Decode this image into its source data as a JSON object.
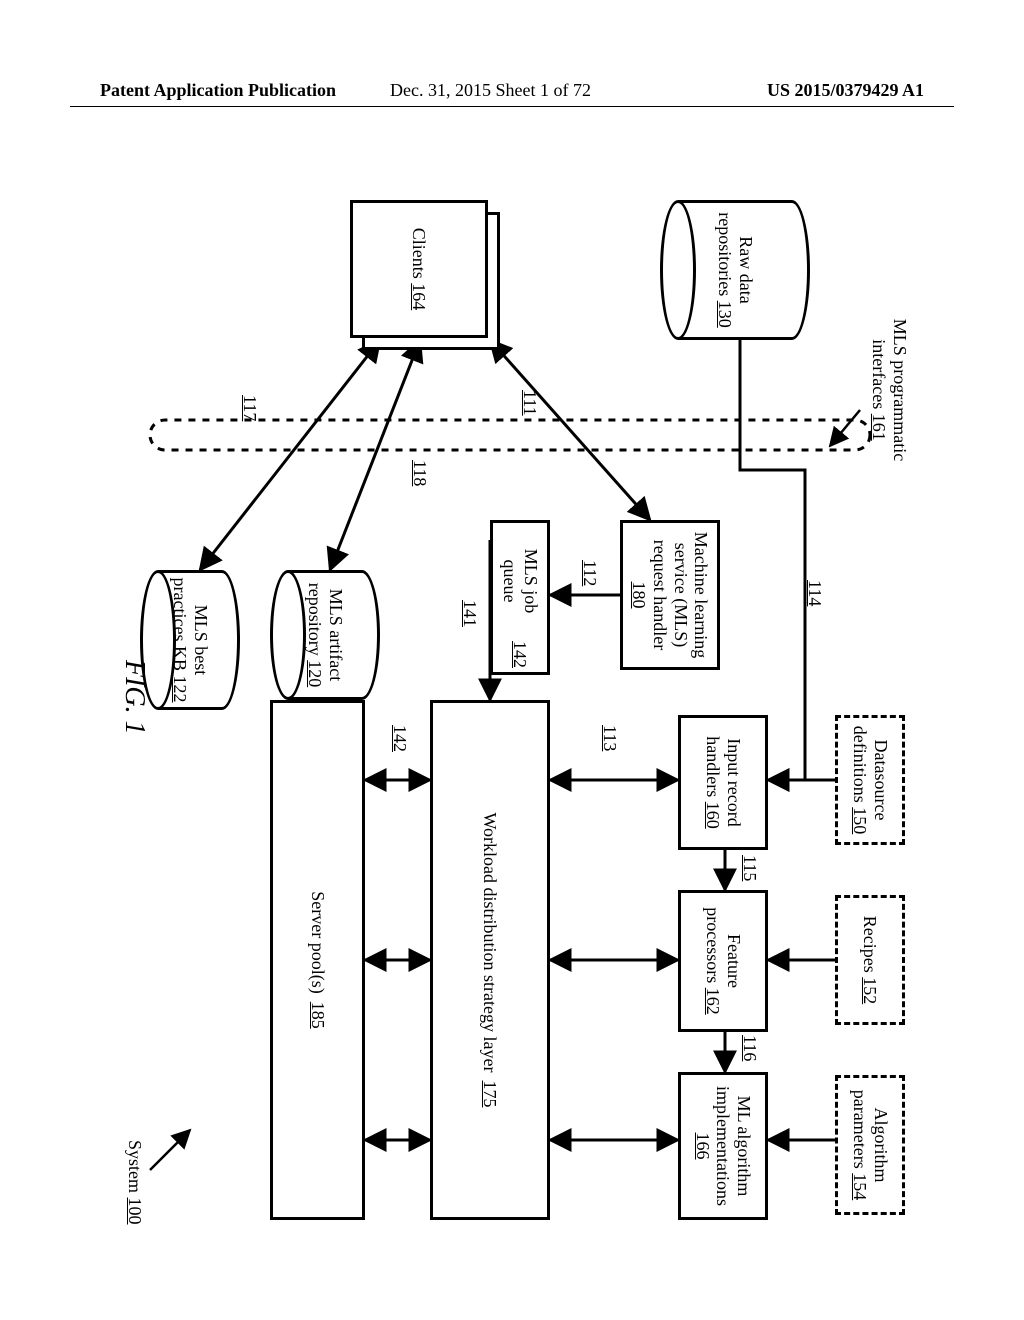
{
  "header": {
    "left": "Patent Application Publication",
    "mid": "Dec. 31, 2015  Sheet 1 of 72",
    "right": "US 2015/0379429 A1"
  },
  "figure_label": "FIG. 1",
  "system_label": "System",
  "system_ref": "100",
  "clients_label": "Clients",
  "clients_ref": "164",
  "raw_data_label1": "Raw data",
  "raw_data_label2": "repositories",
  "raw_data_ref": "130",
  "interfaces_label1": "MLS programmatic",
  "interfaces_label2": "interfaces",
  "interfaces_ref": "161",
  "req_handler_l1": "Machine learning",
  "req_handler_l2": "service (MLS)",
  "req_handler_l3": "request handler",
  "req_handler_ref": "180",
  "job_queue_label": "MLS job queue",
  "job_queue_ref": "142",
  "artifact_l1": "MLS artifact",
  "artifact_l2": "repository",
  "artifact_ref": "120",
  "bestpr_l1": "MLS best",
  "bestpr_l2": "practices KB",
  "bestpr_ref": "122",
  "datasource_l1": "Datasource",
  "datasource_l2": "definitions",
  "datasource_ref": "150",
  "recipes_label": "Recipes",
  "recipes_ref": "152",
  "algparams_l1": "Algorithm",
  "algparams_l2": "parameters",
  "algparams_ref": "154",
  "inrec_l1": "Input record",
  "inrec_l2": "handlers",
  "inrec_ref": "160",
  "featproc_l1": "Feature",
  "featproc_l2": "processors",
  "featproc_ref": "162",
  "mlalg_l1": "ML algorithm",
  "mlalg_l2": "implementations",
  "mlalg_ref": "166",
  "workload_label": "Workload distribution strategy layer",
  "workload_ref": "175",
  "serverpool_label": "Server pool(s)",
  "serverpool_ref": "185",
  "arrow_111": "111",
  "arrow_112": "112",
  "arrow_113": "113",
  "arrow_114": "114",
  "arrow_115": "115",
  "arrow_116": "116",
  "arrow_117": "117",
  "arrow_118": "118",
  "arrow_141": "141",
  "arrow_142": "142"
}
